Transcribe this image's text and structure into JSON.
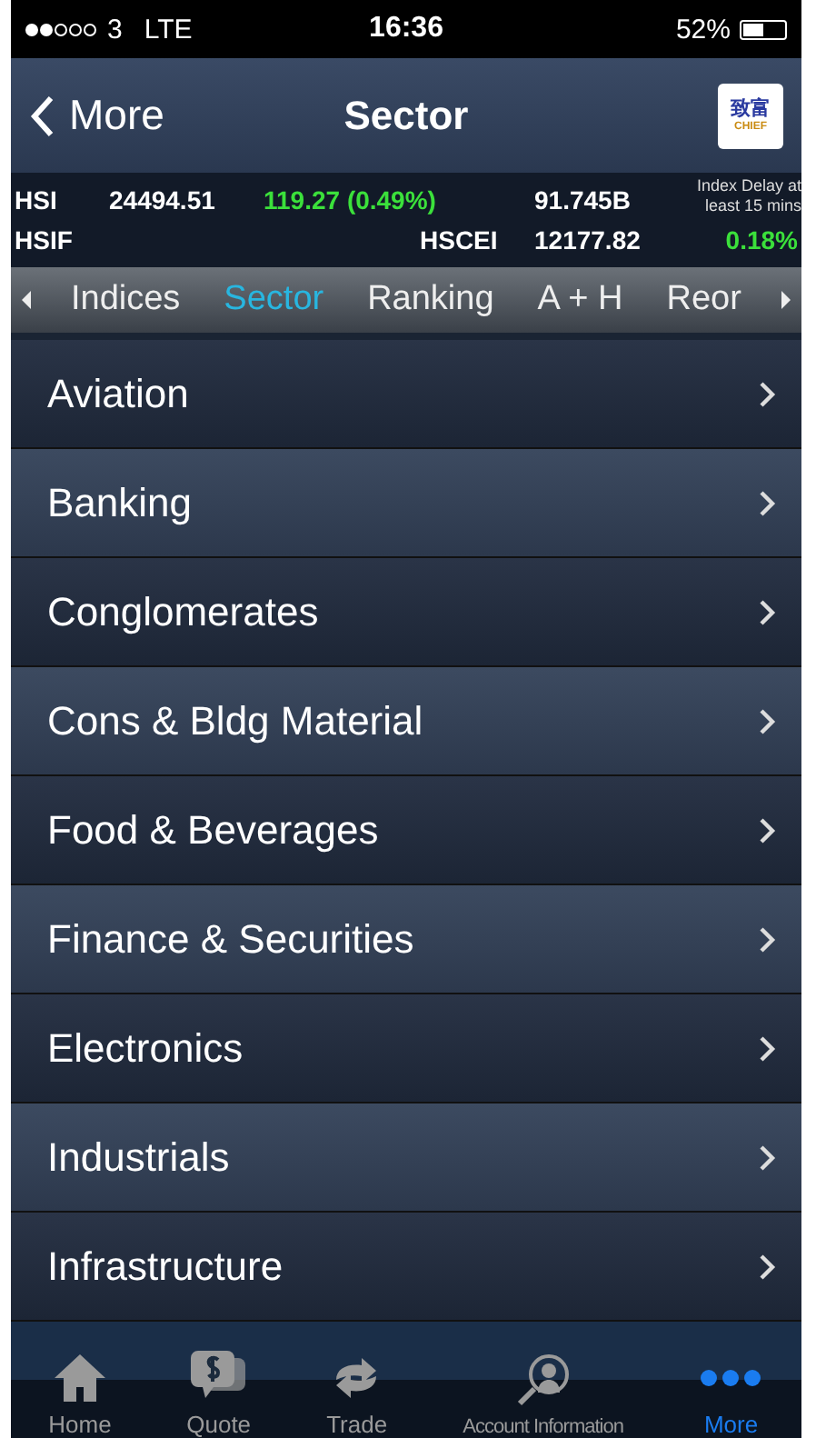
{
  "status_bar": {
    "carrier": "3",
    "network": "LTE",
    "time": "16:36",
    "battery": "52%"
  },
  "nav": {
    "back": "More",
    "title": "Sector",
    "logo_cjk": "致富",
    "logo_text": "CHIEF"
  },
  "ticker": {
    "row_1": [
      "HSI",
      "24494.51",
      "119.27 (0.49%)",
      "91.745B"
    ],
    "row_2": [
      "HSIF",
      "HSCEI",
      "12177.82",
      "0.18%"
    ],
    "delay_note": "Index Delay at least 15 mins"
  },
  "tabs": [
    {
      "label": "Indices",
      "selected": false
    },
    {
      "label": "Sector",
      "selected": true
    },
    {
      "label": "Ranking",
      "selected": false
    },
    {
      "label": "A + H",
      "selected": false
    },
    {
      "label": "Reor",
      "selected": false
    }
  ],
  "sectors": [
    "Aviation",
    "Banking",
    "Conglomerates",
    "Cons & Bldg Material",
    "Food & Beverages",
    "Finance & Securities",
    "Electronics",
    "Industrials",
    "Infrastructure"
  ],
  "tab_bar": [
    {
      "label": "Home",
      "kind": "home",
      "selected": false
    },
    {
      "label": "Quote",
      "kind": "quote",
      "selected": false
    },
    {
      "label": "Trade",
      "kind": "trade",
      "selected": false
    },
    {
      "label": "Account Information",
      "kind": "account",
      "selected": false
    },
    {
      "label": "More",
      "kind": "more",
      "selected": true
    }
  ]
}
